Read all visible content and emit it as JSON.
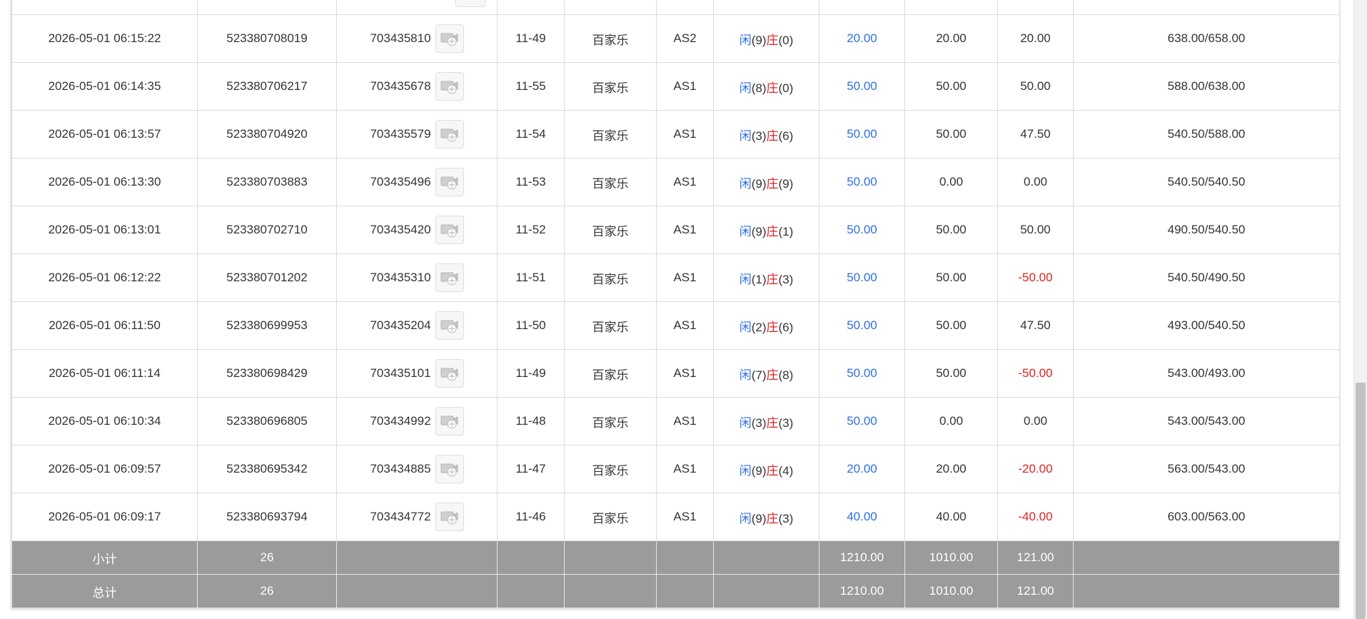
{
  "rows": [
    {
      "time": "2026-05-01 06:15:22",
      "order_no": "523380708019",
      "game_no": "703435810",
      "shoe": "11-49",
      "game": "百家乐",
      "table": "AS2",
      "player_label": "闲",
      "player_val": "(9)",
      "banker_label": "庄",
      "banker_val": "(0)",
      "bet": "20.00",
      "valid_bet": "20.00",
      "win_loss": "20.00",
      "balance": "638.00/658.00",
      "win_loss_color": "dark"
    },
    {
      "time": "2026-05-01 06:14:35",
      "order_no": "523380706217",
      "game_no": "703435678",
      "shoe": "11-55",
      "game": "百家乐",
      "table": "AS1",
      "player_label": "闲",
      "player_val": "(8)",
      "banker_label": "庄",
      "banker_val": "(0)",
      "bet": "50.00",
      "valid_bet": "50.00",
      "win_loss": "50.00",
      "balance": "588.00/638.00",
      "win_loss_color": "dark"
    },
    {
      "time": "2026-05-01 06:13:57",
      "order_no": "523380704920",
      "game_no": "703435579",
      "shoe": "11-54",
      "game": "百家乐",
      "table": "AS1",
      "player_label": "闲",
      "player_val": "(3)",
      "banker_label": "庄",
      "banker_val": "(6)",
      "bet": "50.00",
      "valid_bet": "50.00",
      "win_loss": "47.50",
      "balance": "540.50/588.00",
      "win_loss_color": "dark"
    },
    {
      "time": "2026-05-01 06:13:30",
      "order_no": "523380703883",
      "game_no": "703435496",
      "shoe": "11-53",
      "game": "百家乐",
      "table": "AS1",
      "player_label": "闲",
      "player_val": "(9)",
      "banker_label": "庄",
      "banker_val": "(9)",
      "bet": "50.00",
      "valid_bet": "0.00",
      "win_loss": "0.00",
      "balance": "540.50/540.50",
      "win_loss_color": "dark"
    },
    {
      "time": "2026-05-01 06:13:01",
      "order_no": "523380702710",
      "game_no": "703435420",
      "shoe": "11-52",
      "game": "百家乐",
      "table": "AS1",
      "player_label": "闲",
      "player_val": "(9)",
      "banker_label": "庄",
      "banker_val": "(1)",
      "bet": "50.00",
      "valid_bet": "50.00",
      "win_loss": "50.00",
      "balance": "490.50/540.50",
      "win_loss_color": "dark"
    },
    {
      "time": "2026-05-01 06:12:22",
      "order_no": "523380701202",
      "game_no": "703435310",
      "shoe": "11-51",
      "game": "百家乐",
      "table": "AS1",
      "player_label": "闲",
      "player_val": "(1)",
      "banker_label": "庄",
      "banker_val": "(3)",
      "bet": "50.00",
      "valid_bet": "50.00",
      "win_loss": "-50.00",
      "balance": "540.50/490.50",
      "win_loss_color": "red"
    },
    {
      "time": "2026-05-01 06:11:50",
      "order_no": "523380699953",
      "game_no": "703435204",
      "shoe": "11-50",
      "game": "百家乐",
      "table": "AS1",
      "player_label": "闲",
      "player_val": "(2)",
      "banker_label": "庄",
      "banker_val": "(6)",
      "bet": "50.00",
      "valid_bet": "50.00",
      "win_loss": "47.50",
      "balance": "493.00/540.50",
      "win_loss_color": "dark"
    },
    {
      "time": "2026-05-01 06:11:14",
      "order_no": "523380698429",
      "game_no": "703435101",
      "shoe": "11-49",
      "game": "百家乐",
      "table": "AS1",
      "player_label": "闲",
      "player_val": "(7)",
      "banker_label": "庄",
      "banker_val": "(8)",
      "bet": "50.00",
      "valid_bet": "50.00",
      "win_loss": "-50.00",
      "balance": "543.00/493.00",
      "win_loss_color": "red"
    },
    {
      "time": "2026-05-01 06:10:34",
      "order_no": "523380696805",
      "game_no": "703434992",
      "shoe": "11-48",
      "game": "百家乐",
      "table": "AS1",
      "player_label": "闲",
      "player_val": "(3)",
      "banker_label": "庄",
      "banker_val": "(3)",
      "bet": "50.00",
      "valid_bet": "0.00",
      "win_loss": "0.00",
      "balance": "543.00/543.00",
      "win_loss_color": "dark"
    },
    {
      "time": "2026-05-01 06:09:57",
      "order_no": "523380695342",
      "game_no": "703434885",
      "shoe": "11-47",
      "game": "百家乐",
      "table": "AS1",
      "player_label": "闲",
      "player_val": "(9)",
      "banker_label": "庄",
      "banker_val": "(4)",
      "bet": "20.00",
      "valid_bet": "20.00",
      "win_loss": "-20.00",
      "balance": "563.00/543.00",
      "win_loss_color": "red"
    },
    {
      "time": "2026-05-01 06:09:17",
      "order_no": "523380693794",
      "game_no": "703434772",
      "shoe": "11-46",
      "game": "百家乐",
      "table": "AS1",
      "player_label": "闲",
      "player_val": "(9)",
      "banker_label": "庄",
      "banker_val": "(3)",
      "bet": "40.00",
      "valid_bet": "40.00",
      "win_loss": "-40.00",
      "balance": "603.00/563.00",
      "win_loss_color": "red"
    }
  ],
  "subtotal": {
    "label": "小计",
    "count": "26",
    "bet": "1210.00",
    "valid_bet": "1010.00",
    "win_loss": "121.00"
  },
  "total": {
    "label": "总计",
    "count": "26",
    "bet": "1210.00",
    "valid_bet": "1010.00",
    "win_loss": "121.00"
  },
  "icons": {
    "video_replay": "video-replay-icon"
  },
  "colors": {
    "bet_blue": "#2f6fe0",
    "loss_red": "#e02222",
    "banker_red": "#e02222",
    "player_blue": "#2f6fe0",
    "summary_bg": "#9b9b9b"
  }
}
